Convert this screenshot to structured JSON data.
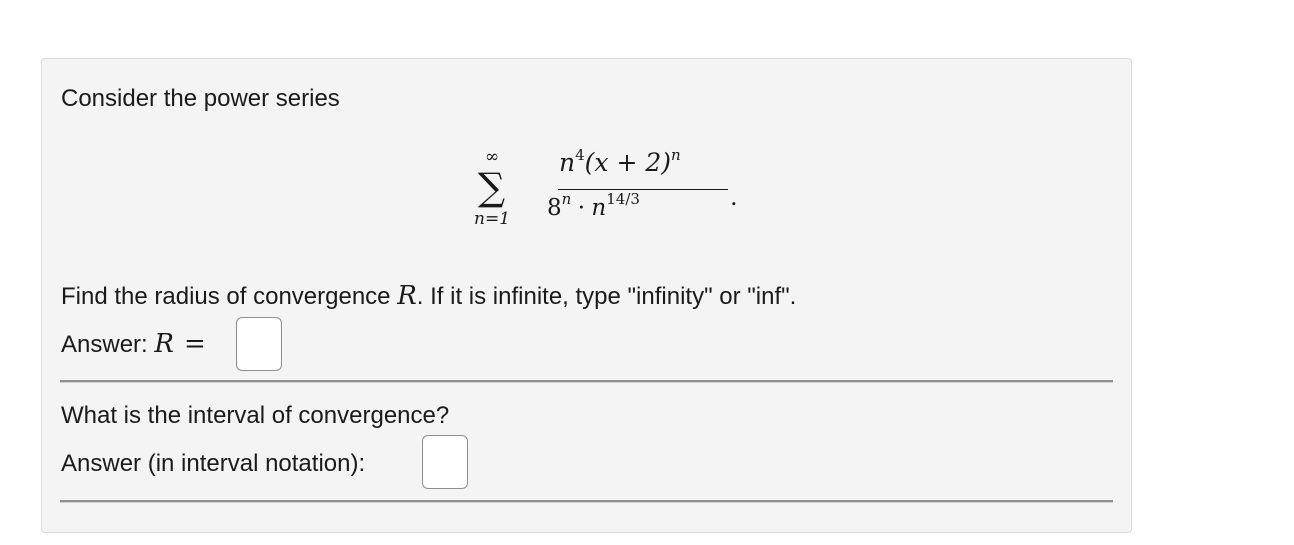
{
  "question": {
    "intro": "Consider the power series",
    "formula": {
      "sum_upper": "∞",
      "sum_lower": "n=1",
      "numerator_n": "n",
      "numerator_exp": "4",
      "numerator_paren": "(x + 2)",
      "numerator_paren_exp": "n",
      "denominator_base": "8",
      "denominator_base_exp": "n",
      "denominator_dot": "·",
      "denominator_n": "n",
      "denominator_exp": "14/3",
      "trailing_period": "."
    },
    "part1": {
      "prompt_before": "Find the radius of convergence ",
      "prompt_var": "R",
      "prompt_after": ". If it is infinite, type \"infinity\" or \"inf\".",
      "answer_label": "Answer: ",
      "answer_var": "R",
      "answer_equals": "=",
      "answer_value": ""
    },
    "part2": {
      "prompt": "What is the interval of convergence?",
      "answer_label": "Answer (in interval notation):",
      "answer_value": ""
    }
  }
}
